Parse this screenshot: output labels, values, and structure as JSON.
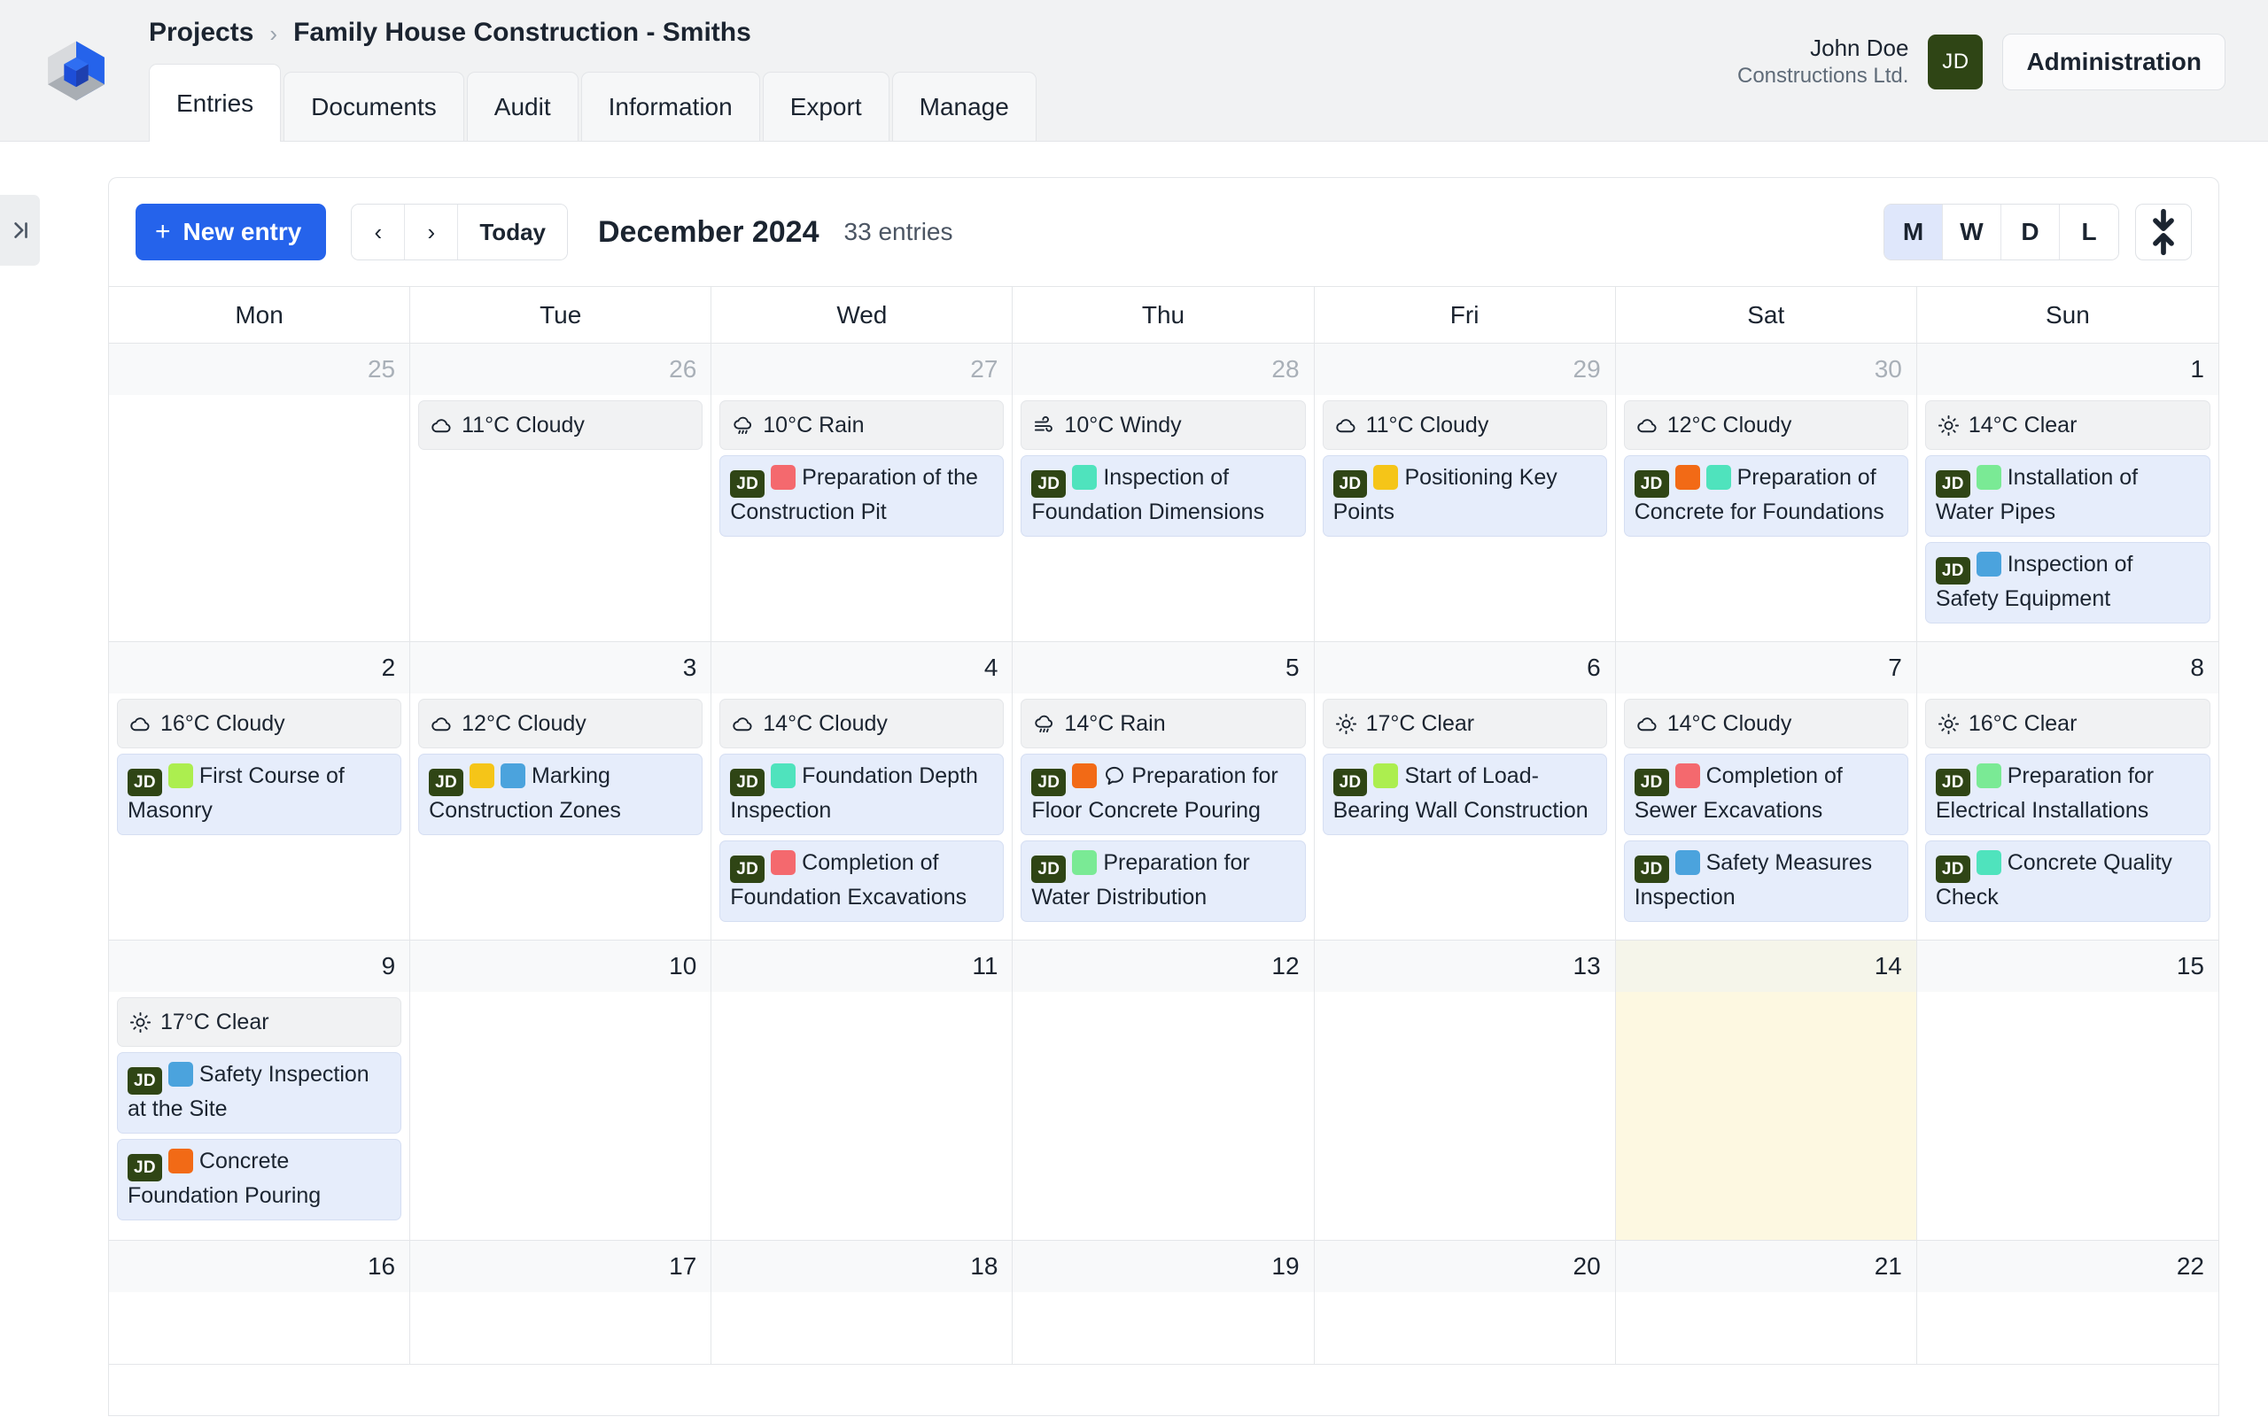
{
  "header": {
    "logo_icon": "cube-logo-icon",
    "breadcrumb": {
      "root": "Projects",
      "separator": "›",
      "current": "Family House Construction - Smiths"
    },
    "tabs": [
      {
        "label": "Entries",
        "active": true
      },
      {
        "label": "Documents",
        "active": false
      },
      {
        "label": "Audit",
        "active": false
      },
      {
        "label": "Information",
        "active": false
      },
      {
        "label": "Export",
        "active": false
      },
      {
        "label": "Manage",
        "active": false
      }
    ],
    "user": {
      "name": "John Doe",
      "org": "Constructions Ltd.",
      "initials": "JD"
    },
    "admin_button": "Administration"
  },
  "rail": {
    "collapse_icon": "expand-sidebar-icon"
  },
  "toolbar": {
    "new_entry_label": "New entry",
    "new_entry_plus": "+",
    "prev_label": "‹",
    "next_label": "›",
    "today_label": "Today",
    "period": "December 2024",
    "entries_count": "33 entries",
    "views": [
      {
        "label": "M",
        "active": true
      },
      {
        "label": "W",
        "active": false
      },
      {
        "label": "D",
        "active": false
      },
      {
        "label": "L",
        "active": false
      }
    ],
    "expand_icon": "expand-collapse-rows-icon"
  },
  "calendar": {
    "weekday_headers": [
      "Mon",
      "Tue",
      "Wed",
      "Thu",
      "Fri",
      "Sat",
      "Sun"
    ],
    "colors": {
      "entry_bg": "#e6edfb",
      "weather_bg": "#f1f2f3",
      "today_bg": "#fdf8e1",
      "badge_bg": "#2f4515",
      "accent_blue": "#2563eb",
      "tag_red": "#f4696e",
      "tag_teal": "#4fe3bd",
      "tag_yellow": "#f5c518",
      "tag_orange": "#f26a16",
      "tag_blue": "#4ba3dd",
      "tag_lime": "#acee4f",
      "tag_green": "#7aea95"
    },
    "weeks": [
      {
        "days": [
          {
            "num": "25",
            "muted": true,
            "today": false,
            "weather": null,
            "entries": []
          },
          {
            "num": "26",
            "muted": true,
            "today": false,
            "weather": {
              "icon": "cloud-icon",
              "text": "11°C Cloudy"
            },
            "entries": []
          },
          {
            "num": "27",
            "muted": true,
            "today": false,
            "weather": {
              "icon": "rain-icon",
              "text": "10°C Rain"
            },
            "entries": [
              {
                "badge": "JD",
                "tags": [
                  "#f4696e"
                ],
                "comment": false,
                "title": "Preparation of the Construction Pit"
              }
            ]
          },
          {
            "num": "28",
            "muted": true,
            "today": false,
            "weather": {
              "icon": "wind-icon",
              "text": "10°C Windy"
            },
            "entries": [
              {
                "badge": "JD",
                "tags": [
                  "#4fe3bd"
                ],
                "comment": false,
                "title": "Inspection of Foundation Dimensions"
              }
            ]
          },
          {
            "num": "29",
            "muted": true,
            "today": false,
            "weather": {
              "icon": "cloud-icon",
              "text": "11°C Cloudy"
            },
            "entries": [
              {
                "badge": "JD",
                "tags": [
                  "#f5c518"
                ],
                "comment": false,
                "title": "Positioning Key Points"
              }
            ]
          },
          {
            "num": "30",
            "muted": true,
            "today": false,
            "weather": {
              "icon": "cloud-icon",
              "text": "12°C Cloudy"
            },
            "entries": [
              {
                "badge": "JD",
                "tags": [
                  "#f26a16",
                  "#4fe3bd"
                ],
                "comment": false,
                "title": "Preparation of Concrete for Foundations"
              }
            ]
          },
          {
            "num": "1",
            "muted": false,
            "today": false,
            "weather": {
              "icon": "sun-icon",
              "text": "14°C Clear"
            },
            "entries": [
              {
                "badge": "JD",
                "tags": [
                  "#7aea95"
                ],
                "comment": false,
                "title": "Installation of Water Pipes"
              },
              {
                "badge": "JD",
                "tags": [
                  "#4ba3dd"
                ],
                "comment": false,
                "title": "Inspection of Safety Equipment"
              }
            ]
          }
        ]
      },
      {
        "days": [
          {
            "num": "2",
            "muted": false,
            "today": false,
            "weather": {
              "icon": "cloud-icon",
              "text": "16°C Cloudy"
            },
            "entries": [
              {
                "badge": "JD",
                "tags": [
                  "#acee4f"
                ],
                "comment": false,
                "title": "First Course of Masonry"
              }
            ]
          },
          {
            "num": "3",
            "muted": false,
            "today": false,
            "weather": {
              "icon": "cloud-icon",
              "text": "12°C Cloudy"
            },
            "entries": [
              {
                "badge": "JD",
                "tags": [
                  "#f5c518",
                  "#4ba3dd"
                ],
                "comment": false,
                "title": "Marking Construction Zones"
              }
            ]
          },
          {
            "num": "4",
            "muted": false,
            "today": false,
            "weather": {
              "icon": "cloud-icon",
              "text": "14°C Cloudy"
            },
            "entries": [
              {
                "badge": "JD",
                "tags": [
                  "#4fe3bd"
                ],
                "comment": false,
                "title": "Foundation Depth Inspection"
              },
              {
                "badge": "JD",
                "tags": [
                  "#f4696e"
                ],
                "comment": false,
                "title": "Completion of Foundation Excavations"
              }
            ]
          },
          {
            "num": "5",
            "muted": false,
            "today": false,
            "weather": {
              "icon": "rain-icon",
              "text": "14°C Rain"
            },
            "entries": [
              {
                "badge": "JD",
                "tags": [
                  "#f26a16"
                ],
                "comment": true,
                "title": "Preparation for Floor Concrete Pouring"
              },
              {
                "badge": "JD",
                "tags": [
                  "#7aea95"
                ],
                "comment": false,
                "title": "Preparation for Water Distribution"
              }
            ]
          },
          {
            "num": "6",
            "muted": false,
            "today": false,
            "weather": {
              "icon": "sun-icon",
              "text": "17°C Clear"
            },
            "entries": [
              {
                "badge": "JD",
                "tags": [
                  "#acee4f"
                ],
                "comment": false,
                "title": "Start of Load-Bearing Wall Construction"
              }
            ]
          },
          {
            "num": "7",
            "muted": false,
            "today": false,
            "weather": {
              "icon": "cloud-icon",
              "text": "14°C Cloudy"
            },
            "entries": [
              {
                "badge": "JD",
                "tags": [
                  "#f4696e"
                ],
                "comment": false,
                "title": "Completion of Sewer Excavations"
              },
              {
                "badge": "JD",
                "tags": [
                  "#4ba3dd"
                ],
                "comment": false,
                "title": "Safety Measures Inspection"
              }
            ]
          },
          {
            "num": "8",
            "muted": false,
            "today": false,
            "weather": {
              "icon": "sun-icon",
              "text": "16°C Clear"
            },
            "entries": [
              {
                "badge": "JD",
                "tags": [
                  "#7aea95"
                ],
                "comment": false,
                "title": "Preparation for Electrical Installations"
              },
              {
                "badge": "JD",
                "tags": [
                  "#4fe3bd"
                ],
                "comment": false,
                "title": "Concrete Quality Check"
              }
            ]
          }
        ]
      },
      {
        "days": [
          {
            "num": "9",
            "muted": false,
            "today": false,
            "weather": {
              "icon": "sun-icon",
              "text": "17°C Clear"
            },
            "entries": [
              {
                "badge": "JD",
                "tags": [
                  "#4ba3dd"
                ],
                "comment": false,
                "title": "Safety Inspection at the Site"
              },
              {
                "badge": "JD",
                "tags": [
                  "#f26a16"
                ],
                "comment": false,
                "title": "Concrete Foundation Pouring"
              }
            ]
          },
          {
            "num": "10",
            "muted": false,
            "today": false,
            "weather": null,
            "entries": []
          },
          {
            "num": "11",
            "muted": false,
            "today": false,
            "weather": null,
            "entries": []
          },
          {
            "num": "12",
            "muted": false,
            "today": false,
            "weather": null,
            "entries": []
          },
          {
            "num": "13",
            "muted": false,
            "today": false,
            "weather": null,
            "entries": []
          },
          {
            "num": "14",
            "muted": false,
            "today": true,
            "weather": null,
            "entries": []
          },
          {
            "num": "15",
            "muted": false,
            "today": false,
            "weather": null,
            "entries": []
          }
        ]
      },
      {
        "days": [
          {
            "num": "16",
            "muted": false,
            "today": false,
            "weather": null,
            "entries": []
          },
          {
            "num": "17",
            "muted": false,
            "today": false,
            "weather": null,
            "entries": []
          },
          {
            "num": "18",
            "muted": false,
            "today": false,
            "weather": null,
            "entries": []
          },
          {
            "num": "19",
            "muted": false,
            "today": false,
            "weather": null,
            "entries": []
          },
          {
            "num": "20",
            "muted": false,
            "today": false,
            "weather": null,
            "entries": []
          },
          {
            "num": "21",
            "muted": false,
            "today": false,
            "weather": null,
            "entries": []
          },
          {
            "num": "22",
            "muted": false,
            "today": false,
            "weather": null,
            "entries": []
          }
        ]
      }
    ]
  }
}
